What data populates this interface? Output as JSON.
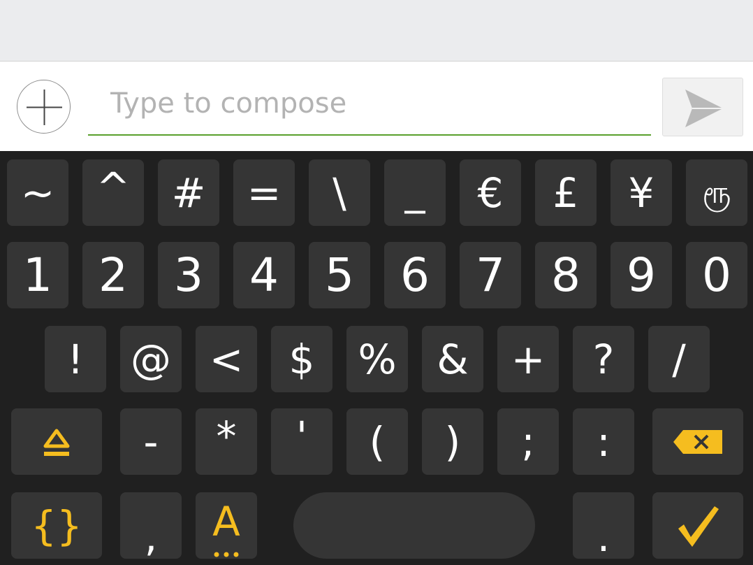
{
  "compose": {
    "placeholder": "Type to compose",
    "value": ""
  },
  "icons": {
    "attach": "plus-icon",
    "send": "send-icon",
    "shift": "shift-icon",
    "backspace": "backspace-icon",
    "enter": "checkmark-icon"
  },
  "colors": {
    "accent_underline": "#5aa02c",
    "keyboard_accent": "#f5bd1f",
    "key_bg": "#353535",
    "keyboard_bg": "#202020"
  },
  "keyboard": {
    "row1": [
      "~",
      "^",
      "#",
      "=",
      "\\",
      "_",
      "€",
      "£",
      "¥",
      "ரூ"
    ],
    "row2": [
      "1",
      "2",
      "3",
      "4",
      "5",
      "6",
      "7",
      "8",
      "9",
      "0"
    ],
    "row3": [
      "!",
      "@",
      "<",
      "$",
      "%",
      "&",
      "+",
      "?",
      "/"
    ],
    "row4": [
      "-",
      "*",
      "'",
      "(",
      ")",
      ";",
      ":"
    ],
    "row5": {
      "symbols": "{}",
      "comma": ",",
      "alpha": "A",
      "period": "."
    }
  }
}
